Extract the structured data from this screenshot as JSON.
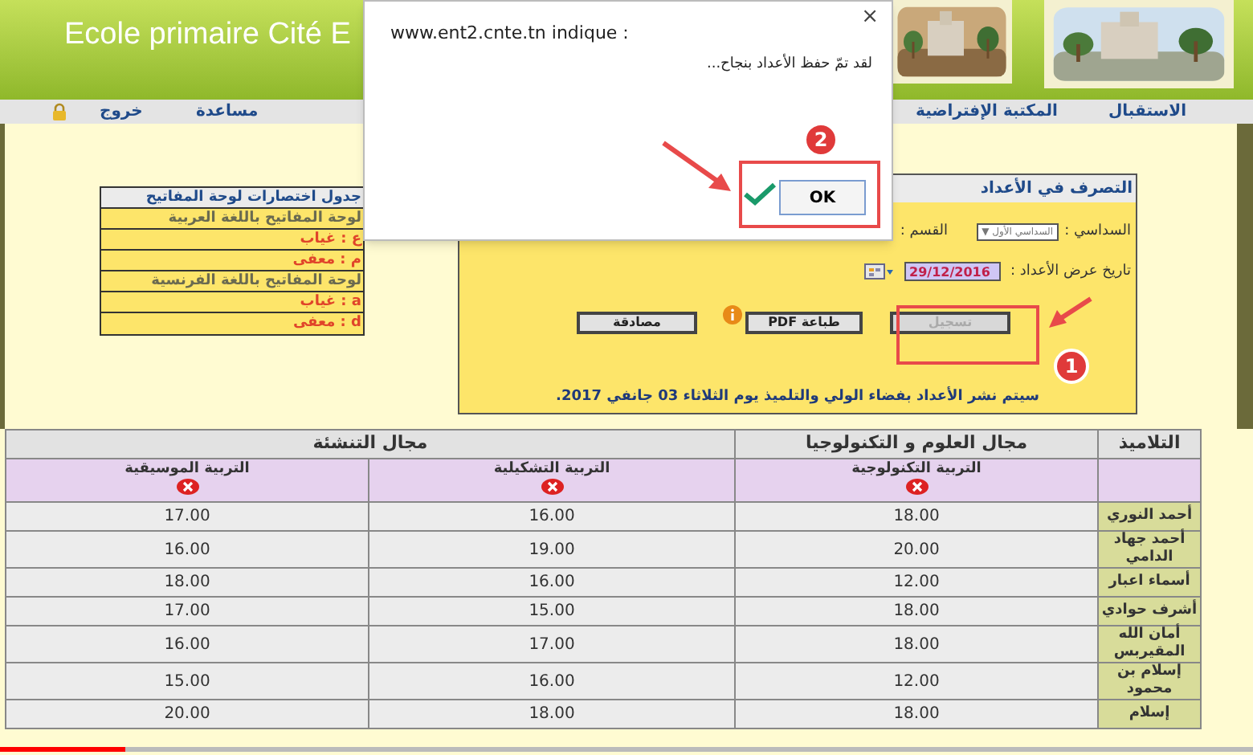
{
  "header": {
    "title": "Ecole primaire Cité E"
  },
  "nav": {
    "items": [
      {
        "label": "الاستقبال"
      },
      {
        "label": "المكتبة الإفتراضية"
      }
    ],
    "left_items": [
      {
        "label": "مساعدة",
        "kind": "text"
      },
      {
        "label": "خروج",
        "kind": "lock"
      }
    ]
  },
  "shortcuts": {
    "title": "جدول اختصارات لوحة المفاتيح",
    "rows": [
      {
        "text": "لوحة المفاتيح باللغة العربية",
        "kind": "heading"
      },
      {
        "text": "ع : غياب",
        "kind": "key"
      },
      {
        "text": "م : معفى",
        "kind": "key"
      },
      {
        "text": "لوحة المفاتيح باللغة الفرنسية",
        "kind": "heading"
      },
      {
        "text": "a : غياب",
        "kind": "key"
      },
      {
        "text": "d : معفى",
        "kind": "key"
      }
    ]
  },
  "panel": {
    "title": "التصرف في الأعداد",
    "semester_label": "السداسي :",
    "semester_value": "السداسي الأول",
    "semester_arrow": "▼",
    "class_label": "القسم :",
    "date_label": "تاريخ عرض الأعداد :",
    "date_value": "29/12/2016",
    "buttons": [
      {
        "label": "تسجيل",
        "disabled": true
      },
      {
        "label": "طباعة PDF",
        "disabled": false
      },
      {
        "label": "مصادقة",
        "disabled": false
      }
    ],
    "note": "سيتم نشر الأعداد بفضاء الولي والتلميذ يوم الثلاثاء 03 جانفي 2017."
  },
  "table": {
    "student_header": "التلاميذ",
    "groups": [
      {
        "label": "مجال العلوم و التكنولوجيا"
      },
      {
        "label": "مجال التنشئة"
      }
    ],
    "subjects": [
      "التربية التكنولوجية",
      "التربية التشكيلية",
      "التربية الموسيقية"
    ],
    "rows": [
      {
        "name": "أحمد النوري",
        "grades": [
          "18.00",
          "16.00",
          "17.00"
        ]
      },
      {
        "name": "أحمد جهاد الدامي",
        "grades": [
          "20.00",
          "19.00",
          "16.00"
        ]
      },
      {
        "name": "أسماء اعبار",
        "grades": [
          "12.00",
          "16.00",
          "18.00"
        ]
      },
      {
        "name": "أشرف حوادي",
        "grades": [
          "18.00",
          "15.00",
          "17.00"
        ]
      },
      {
        "name": "أمان الله المقيربس",
        "grades": [
          "18.00",
          "17.00",
          "16.00"
        ]
      },
      {
        "name": "إسلام بن محمود",
        "grades": [
          "12.00",
          "16.00",
          "15.00"
        ]
      },
      {
        "name": "إسلام",
        "grades": [
          "18.00",
          "18.00",
          "20.00"
        ]
      }
    ]
  },
  "dialog": {
    "origin": "www.ent2.cnte.tn indique :",
    "message": "لقد تمّ حفظ الأعداد بنجاح...",
    "close": "×",
    "ok": "OK"
  },
  "annotations": [
    {
      "badge": "2"
    },
    {
      "badge": "1"
    }
  ],
  "video": {
    "level": 0.1
  }
}
